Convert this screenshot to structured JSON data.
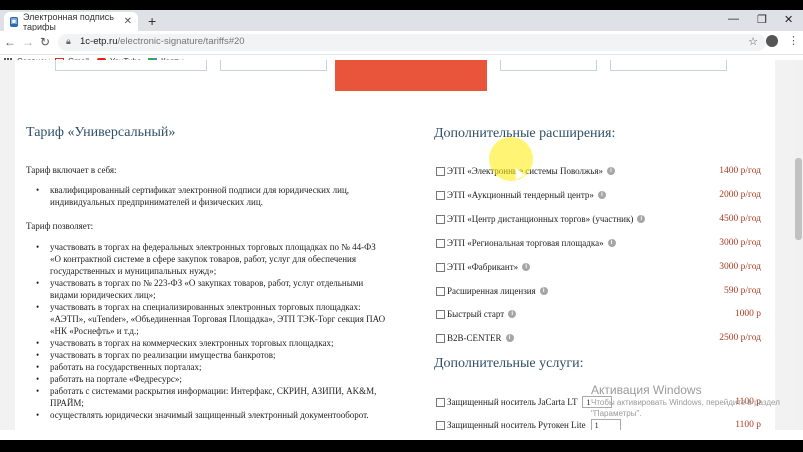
{
  "browser": {
    "tab_title": "Электронная подпись тарифы",
    "url_host": "1c-etp.ru",
    "url_path": "/electronic-signature/tariffs#20",
    "bookmarks": [
      "Сервисы",
      "Gmail",
      "YouTube",
      "Карты"
    ]
  },
  "tariff": {
    "title": "Тариф «Универсальный»",
    "includes_label": "Тариф включает в себя:",
    "includes": [
      "квалифицированный сертификат электронной подписи для юридических лиц, индивидуальных предпринимателей и физических лиц."
    ],
    "allows_label": "Тариф позволяет:",
    "allows": [
      "участвовать в торгах на федеральных электронных торговых площадках по № 44-ФЗ «О контрактной системе в сфере закупок товаров, работ, услуг для обеспечения государственных и муниципальных нужд»;",
      "участвовать в торгах по № 223-ФЗ «О закупках товаров, работ, услуг отдельными видами юридических лиц»;",
      "участвовать в торгах на специализированных электронных торговых площадках: «АЭТП», «uTender», «Объединенная Торговая Площадка», ЭТП ТЭК-Торг секция ПАО «НК «Роснефть» и т.д.;",
      "участвовать в торгах на коммерческих электронных торговых площадках;",
      "участвовать в торгах по реализации имущества банкротов;",
      "работать на государственных порталах;",
      "работать на портале «Федресурс»;",
      "работать с системами раскрытия информации: Интерфакс, СКРИН, АЗИПИ, AK&M, ПРАЙМ;",
      "осуществлять юридически значимый защищенный электронный документооборот."
    ]
  },
  "extensions": {
    "title": "Дополнительные расширения:",
    "items": [
      {
        "label": "ЭТП «Электронные системы Поволжья»",
        "price": "1400 р/год"
      },
      {
        "label": "ЭТП «Аукционный тендерный центр»",
        "price": "2000 р/год"
      },
      {
        "label": "ЭТП «Центр дистанционных торгов» (участник)",
        "price": "4500 р/год"
      },
      {
        "label": "ЭТП «Региональная торговая площадка»",
        "price": "3000 р/год"
      },
      {
        "label": "ЭТП «Фабрикант»",
        "price": "3000 р/год"
      },
      {
        "label": "Расширенная лицензия",
        "price": "590 р/год"
      },
      {
        "label": "Быстрый старт",
        "price": "1000 р"
      },
      {
        "label": "B2B-CENTER",
        "price": "2500 р/год"
      }
    ]
  },
  "services": {
    "title": "Дополнительные услуги:",
    "items": [
      {
        "label": "Защищенный носитель JaCarta LT",
        "qty": "1",
        "price": "1100 р"
      },
      {
        "label": "Защищенный носитель Рутокен Lite",
        "qty": "1",
        "price": "1100 р"
      }
    ]
  },
  "watermark": {
    "title": "Активация Windows",
    "text": "Чтобы активировать Windows, перейдите в раздел \"Параметры\"."
  }
}
